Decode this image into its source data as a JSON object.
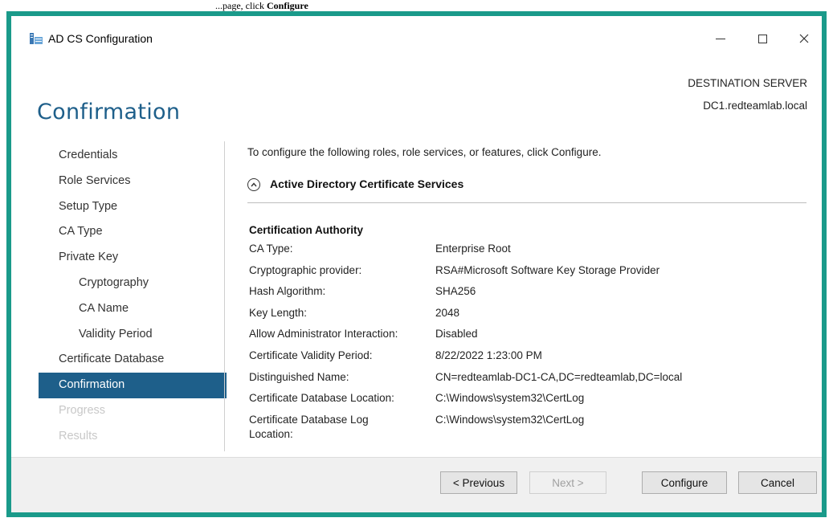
{
  "page_caption": {
    "text": "...page, click ",
    "bold": "Configure"
  },
  "window": {
    "title": "AD CS Configuration",
    "controls": {
      "minimize": "—",
      "maximize": "☐",
      "close": "✕"
    },
    "app_icon": "server-manager-icon"
  },
  "header": {
    "page_title": "Confirmation",
    "destination_label": "DESTINATION SERVER",
    "destination_server": "DC1.redteamlab.local"
  },
  "nav": {
    "items": [
      {
        "label": "Credentials",
        "state": "normal",
        "level": 0
      },
      {
        "label": "Role Services",
        "state": "normal",
        "level": 0
      },
      {
        "label": "Setup Type",
        "state": "normal",
        "level": 0
      },
      {
        "label": "CA Type",
        "state": "normal",
        "level": 0
      },
      {
        "label": "Private Key",
        "state": "normal",
        "level": 0
      },
      {
        "label": "Cryptography",
        "state": "normal",
        "level": 1
      },
      {
        "label": "CA Name",
        "state": "normal",
        "level": 1
      },
      {
        "label": "Validity Period",
        "state": "normal",
        "level": 1
      },
      {
        "label": "Certificate Database",
        "state": "normal",
        "level": 0
      },
      {
        "label": "Confirmation",
        "state": "active",
        "level": 0
      },
      {
        "label": "Progress",
        "state": "disabled",
        "level": 0
      },
      {
        "label": "Results",
        "state": "disabled",
        "level": 0
      }
    ]
  },
  "content": {
    "intro": "To configure the following roles, role services, or features, click Configure.",
    "section_title": "Active Directory Certificate Services",
    "group_heading": "Certification Authority",
    "details": [
      {
        "key": "CA Type:",
        "value": "Enterprise Root"
      },
      {
        "key": "Cryptographic provider:",
        "value": "RSA#Microsoft Software Key Storage Provider"
      },
      {
        "key": "Hash Algorithm:",
        "value": "SHA256"
      },
      {
        "key": "Key Length:",
        "value": "2048"
      },
      {
        "key": "Allow Administrator Interaction:",
        "value": "Disabled"
      },
      {
        "key": "Certificate Validity Period:",
        "value": "8/22/2022 1:23:00 PM"
      },
      {
        "key": "Distinguished Name:",
        "value": "CN=redteamlab-DC1-CA,DC=redteamlab,DC=local"
      },
      {
        "key": "Certificate Database Location:",
        "value": "C:\\Windows\\system32\\CertLog"
      },
      {
        "key": "Certificate Database Log Location:",
        "value": "C:\\Windows\\system32\\CertLog"
      }
    ]
  },
  "footer": {
    "previous": "< Previous",
    "next": "Next >",
    "configure": "Configure",
    "cancel": "Cancel"
  },
  "colors": {
    "window_border": "#1a9a8a",
    "accent": "#1e5f8a",
    "disabled_text": "#c8c8c8"
  }
}
